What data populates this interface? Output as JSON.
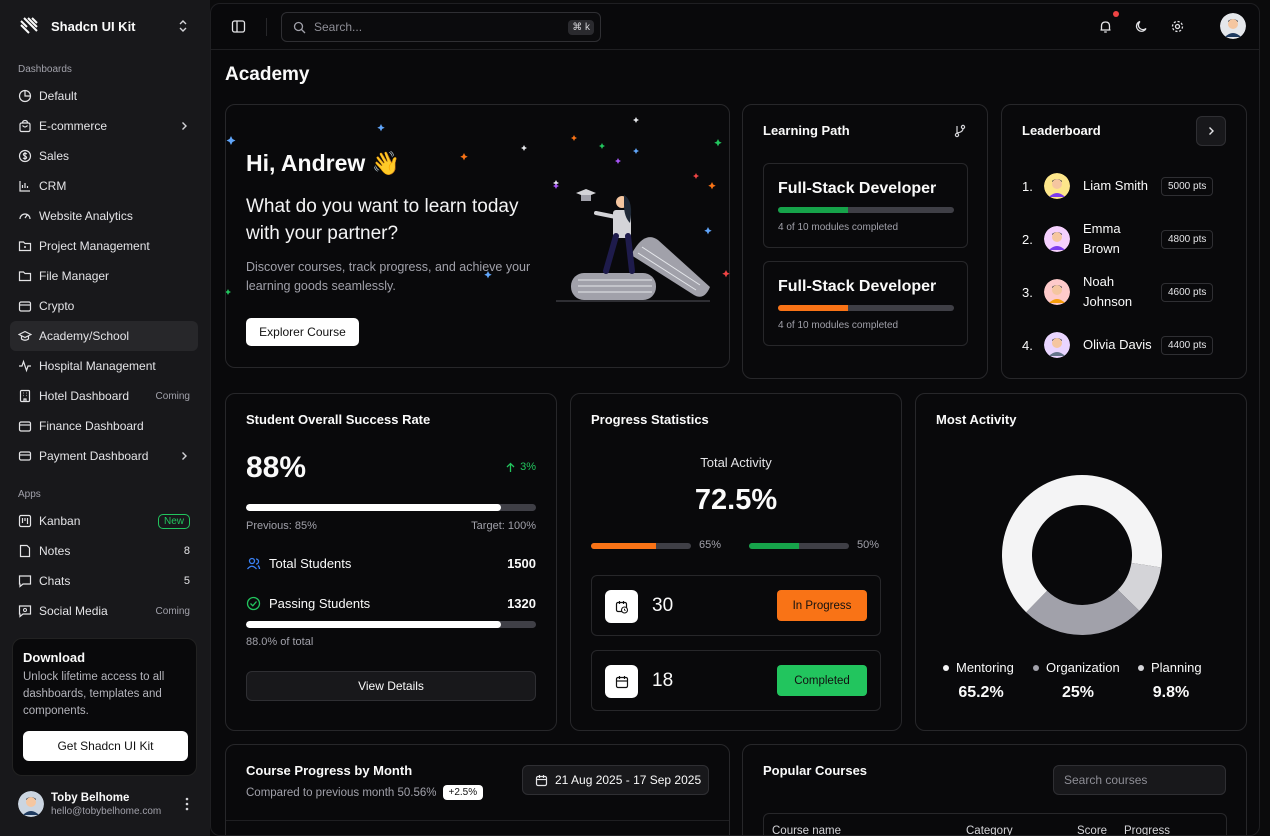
{
  "app": {
    "name": "Shadcn UI Kit"
  },
  "sidebar": {
    "sections": {
      "dashboards": "Dashboards",
      "apps": "Apps"
    },
    "dashboards": [
      {
        "label": "Default",
        "icon": "pie-chart-icon"
      },
      {
        "label": "E-commerce",
        "icon": "shopping-bag-icon",
        "submenu": true
      },
      {
        "label": "Sales",
        "icon": "dollar-circle-icon"
      },
      {
        "label": "CRM",
        "icon": "chart-bars-icon"
      },
      {
        "label": "Website Analytics",
        "icon": "gauge-icon"
      },
      {
        "label": "Project Management",
        "icon": "folder-dot-icon"
      },
      {
        "label": "File Manager",
        "icon": "folder-icon"
      },
      {
        "label": "Crypto",
        "icon": "wallet-icon"
      },
      {
        "label": "Academy/School",
        "icon": "graduation-cap-icon",
        "active": true
      },
      {
        "label": "Hospital Management",
        "icon": "activity-icon"
      },
      {
        "label": "Hotel Dashboard",
        "icon": "building-icon",
        "tag": "Coming"
      },
      {
        "label": "Finance Dashboard",
        "icon": "wallet-icon"
      },
      {
        "label": "Payment Dashboard",
        "icon": "credit-card-icon",
        "submenu": true
      }
    ],
    "apps": [
      {
        "label": "Kanban",
        "icon": "kanban-icon",
        "badge": "New"
      },
      {
        "label": "Notes",
        "icon": "note-icon",
        "count": "8"
      },
      {
        "label": "Chats",
        "icon": "chat-icon",
        "count": "5"
      },
      {
        "label": "Social Media",
        "icon": "social-icon",
        "tag": "Coming"
      }
    ],
    "download": {
      "title": "Download",
      "desc": "Unlock lifetime access to all dashboards, templates and components.",
      "button": "Get Shadcn UI Kit"
    },
    "user": {
      "name": "Toby Belhome",
      "email": "hello@tobybelhome.com"
    }
  },
  "topbar": {
    "search_placeholder": "Search...",
    "shortcut": "⌘ k"
  },
  "page": {
    "title": "Academy"
  },
  "hero": {
    "greeting": "Hi, Andrew 👋",
    "question": "What do you want to learn today with your partner?",
    "desc": "Discover courses, track progress, and achieve your learning goods seamlessly.",
    "button": "Explorer Course"
  },
  "learning_path": {
    "title": "Learning Path",
    "items": [
      {
        "title": "Full-Stack Developer",
        "progress": 0.4,
        "status": "4 of 10 modules completed",
        "color": "#16a34a"
      },
      {
        "title": "Full-Stack Developer",
        "progress": 0.4,
        "status": "4 of 10 modules completed",
        "color": "#f97316"
      }
    ]
  },
  "leaderboard": {
    "title": "Leaderboard",
    "rows": [
      {
        "rank": "1.",
        "name": "Liam Smith",
        "pts": "5000 pts"
      },
      {
        "rank": "2.",
        "name": "Emma Brown",
        "pts": "4800 pts"
      },
      {
        "rank": "3.",
        "name": "Noah Johnson",
        "pts": "4600 pts"
      },
      {
        "rank": "4.",
        "name": "Olivia Davis",
        "pts": "4400 pts"
      }
    ]
  },
  "success": {
    "title": "Student Overall Success Rate",
    "value": "88%",
    "trend": "3%",
    "progress": 0.88,
    "previous": "Previous: 85%",
    "target": "Target: 100%",
    "total_label": "Total Students",
    "total_value": "1500",
    "passing_label": "Passing Students",
    "passing_value": "1320",
    "passing_progress": 0.88,
    "of_total": "88.0% of total",
    "button": "View Details"
  },
  "progress_stats": {
    "title": "Progress Statistics",
    "label": "Total Activity",
    "value": "72.5%",
    "bars": [
      {
        "pct": "65%",
        "progress": 0.65,
        "color": "#f97316"
      },
      {
        "pct": "50%",
        "progress": 0.5,
        "color": "#16a34a"
      }
    ],
    "in_progress": {
      "count": "30",
      "label": "In Progress",
      "color": "#f97316"
    },
    "completed": {
      "count": "18",
      "label": "Completed",
      "color": "#22c55e"
    }
  },
  "most_activity": {
    "title": "Most Activity",
    "segments": [
      {
        "label": "Mentoring",
        "value": "65.2%",
        "share": 65.2,
        "color": "#f4f4f5"
      },
      {
        "label": "Organization",
        "value": "25%",
        "share": 25,
        "color": "#a1a1aa"
      },
      {
        "label": "Planning",
        "value": "9.8%",
        "share": 9.8,
        "color": "#d4d4d8"
      }
    ]
  },
  "course_progress": {
    "title": "Course Progress by Month",
    "subtitle": "Compared to previous month 50.56%",
    "delta": "+2.5%",
    "date_range": "21 Aug 2025 - 17 Sep 2025"
  },
  "popular_courses": {
    "title": "Popular Courses",
    "search_placeholder": "Search courses",
    "columns": [
      "Course name",
      "Category",
      "Score",
      "Progress"
    ]
  }
}
